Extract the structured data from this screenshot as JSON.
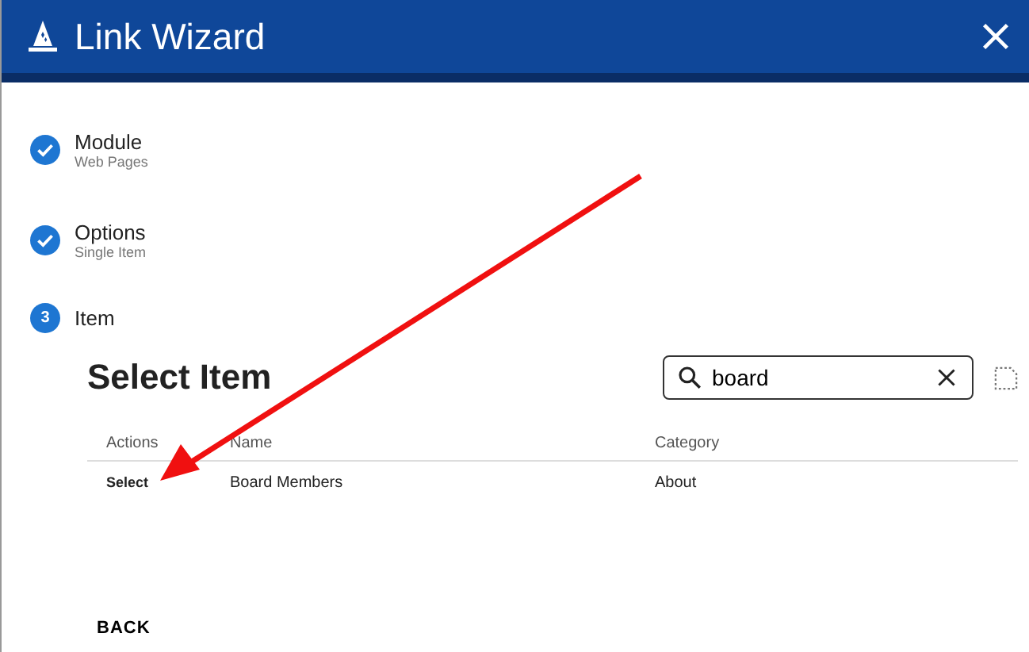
{
  "window": {
    "title": "Link Wizard"
  },
  "steps": [
    {
      "label": "Module",
      "sublabel": "Web Pages",
      "completed": true
    },
    {
      "label": "Options",
      "sublabel": "Single Item",
      "completed": true
    },
    {
      "label": "Item",
      "number": "3",
      "completed": false
    }
  ],
  "panel": {
    "title": "Select Item",
    "search": {
      "value": "board"
    }
  },
  "table": {
    "columns": [
      "Actions",
      "Name",
      "Category"
    ],
    "rows": [
      {
        "action": "Select",
        "name": "Board Members",
        "category": "About"
      }
    ]
  },
  "buttons": [
    "BACK"
  ]
}
